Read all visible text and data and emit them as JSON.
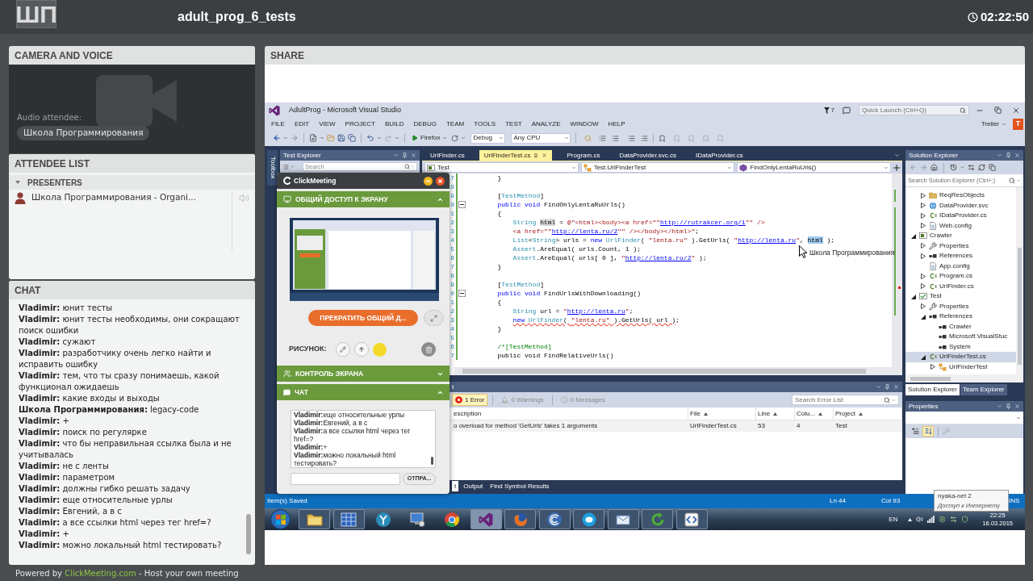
{
  "header": {
    "logo": "ШП",
    "title": "adult_prog_6_tests",
    "timer": "02:22:50"
  },
  "camera_panel": {
    "title": "CAMERA AND VOICE",
    "audio_label": "Audio attendee:",
    "attendee_badge": "Школа Программирования"
  },
  "attendee_panel": {
    "title": "ATTENDEE LIST",
    "groups": [
      {
        "title": "PRESENTERS",
        "expanded": true,
        "attendees": [
          {
            "name": "Школа Программирования - Organi..."
          }
        ]
      }
    ]
  },
  "chat_panel": {
    "title": "CHAT",
    "messages": [
      "**Vladimir:** юнит тесты",
      "**Vladimir:** юнит тесты необходимы, они сокращают поиск ошибки",
      "**Vladimir:** сужают",
      "**Vladimir:** разработчику очень легко найти и исправить ошибку",
      "**Vladimir:** тем, что ты сразу понимаешь, какой функционал ожидаешь",
      "**Vladimir:** какие входы и выходы",
      "**Школа Программирования:** legacy-code",
      "**Vladimir:** +",
      "**Vladimir:** поиск по регулярке",
      "**Vladimir:** что бы неправильная ссылка была и не учитывалась",
      "**Vladimir:** не с ленты",
      "**Vladimir:** параметром",
      "**Vladimir:** должны гибко решать задачу",
      "**Vladimir:** еще относительные урлы",
      "**Vladimir:** Евгений, а в с",
      "**Vladimir:** а все ссылки html через тег href=?",
      "**Vladimir:** +",
      "**Vladimir:** можно локальный html тестировать?"
    ]
  },
  "footer": {
    "prefix": "Powered by",
    "link": "ClickMeeting.com",
    "suffix": "- Host your own meeting"
  },
  "share_panel": {
    "title": "SHARE",
    "shared_screen": {
      "title_bar": {
        "title": "AdultProg - Microsoft Visual Studio",
        "notifications": "7",
        "quick_launch": {
          "placeholder": "Quick Launch (Ctrl+Q)"
        }
      },
      "menu": [
        "FILE",
        "EDIT",
        "VIEW",
        "PROJECT",
        "BUILD",
        "DEBUG",
        "TEAM",
        "TOOLS",
        "TEST",
        "ANALYZE",
        "WINDOW",
        "HELP"
      ],
      "account": {
        "name": "Treller",
        "initial": "T"
      },
      "toolbar": {
        "run_target": "Firefox",
        "configuration": "Debug",
        "platform": "Any CPU"
      },
      "toolbox": {
        "label": "Toolbox"
      },
      "test_explorer": {
        "title": "Test Explorer",
        "search": {
          "placeholder": "Search"
        }
      },
      "editor": {
        "tabs": [
          {
            "label": "UrlFinder.cs",
            "selected": false
          },
          {
            "label": "UrlFinderTest.cs",
            "selected": true
          },
          {
            "label": "Program.cs",
            "selected": false
          },
          {
            "label": "DataProvider.svc.cs",
            "selected": false
          },
          {
            "label": "IDataProvider.cs",
            "selected": false
          }
        ],
        "navigation": [
          {
            "kind": "project",
            "label": "Test"
          },
          {
            "kind": "class",
            "label": "Test.UrlFinderTest"
          },
          {
            "kind": "method",
            "label": "FindOnlyLentaRuUrls()"
          }
        ],
        "lines": [
          {
            "number": "7",
            "segments": [
              {
                "kind": "plain",
                "text": "        }"
              }
            ]
          },
          {
            "number": "8"
          },
          {
            "number": "9",
            "segments": [
              {
                "kind": "plain",
                "text": "        ["
              },
              {
                "kind": "type",
                "text": "TestMethod"
              },
              {
                "kind": "plain",
                "text": "]"
              }
            ]
          },
          {
            "number": "0",
            "expanded": true,
            "segments": [
              {
                "kind": "keyword",
                "text": "        public void"
              },
              {
                "kind": "plain",
                "text": " FindOnlyLentaRuUrls()"
              }
            ]
          },
          {
            "number": "1",
            "segments": [
              {
                "kind": "plain",
                "text": "        {"
              }
            ]
          },
          {
            "number": "2",
            "segments": [
              {
                "kind": "type",
                "text": "            String "
              },
              {
                "kind": "highlight",
                "text": "html"
              },
              {
                "kind": "plain",
                "text": " = "
              },
              {
                "kind": "string",
                "text": "@\"<html><body><a href=\"\""
              },
              {
                "kind": "link",
                "text": "http://rutrakcer.org/1"
              },
              {
                "kind": "string",
                "text": "\"\" />"
              }
            ]
          },
          {
            "number": "3",
            "segments": [
              {
                "kind": "string",
                "text": "            <a href=\"\""
              },
              {
                "kind": "link",
                "text": "http://lenta.ru/2"
              },
              {
                "kind": "string",
                "text": "\"\" /></body></html>\""
              },
              {
                "kind": "plain",
                "text": ";"
              }
            ]
          },
          {
            "number": "4",
            "segments": [
              {
                "kind": "type",
                "text": "            List"
              },
              {
                "kind": "plain",
                "text": "<"
              },
              {
                "kind": "type",
                "text": "String"
              },
              {
                "kind": "plain",
                "text": "> urls = "
              },
              {
                "kind": "keyword",
                "text": "new"
              },
              {
                "kind": "type",
                "text": " UrlFinder"
              },
              {
                "kind": "plain",
                "text": "( "
              },
              {
                "kind": "string",
                "text": "\"lenta.ru\""
              },
              {
                "kind": "plain",
                "text": " ).GetUrls( "
              },
              {
                "kind": "string",
                "text": "\""
              },
              {
                "kind": "link",
                "text": "http://lenta.ru"
              },
              {
                "kind": "string",
                "text": "\""
              },
              {
                "kind": "plain",
                "text": ", "
              },
              {
                "kind": "selection",
                "text": "html"
              },
              {
                "kind": "plain",
                "text": " );"
              }
            ]
          },
          {
            "number": "5",
            "segments": [
              {
                "kind": "type",
                "text": "            Assert"
              },
              {
                "kind": "plain",
                "text": ".AreEqual( urls.Count, 1 );"
              }
            ]
          },
          {
            "number": "6",
            "segments": [
              {
                "kind": "type",
                "text": "            Assert"
              },
              {
                "kind": "plain",
                "text": ".AreEqual( urls[ 0 ], "
              },
              {
                "kind": "string",
                "text": "\""
              },
              {
                "kind": "link",
                "text": "http://lenta.ru/2"
              },
              {
                "kind": "string",
                "text": "\""
              },
              {
                "kind": "plain",
                "text": " );"
              }
            ]
          },
          {
            "number": "7",
            "segments": [
              {
                "kind": "plain",
                "text": "        }"
              }
            ]
          },
          {
            "number": "8"
          },
          {
            "number": "9",
            "segments": [
              {
                "kind": "plain",
                "text": "        ["
              },
              {
                "kind": "type",
                "text": "TestMethod"
              },
              {
                "kind": "plain",
                "text": "]"
              }
            ]
          },
          {
            "number": "0",
            "expanded": true,
            "segments": [
              {
                "kind": "keyword",
                "text": "        public void"
              },
              {
                "kind": "plain",
                "text": " FindUrlsWithDownloading()"
              }
            ]
          },
          {
            "number": "1",
            "segments": [
              {
                "kind": "plain",
                "text": "        {"
              }
            ]
          },
          {
            "number": "2",
            "segments": [
              {
                "kind": "type",
                "text": "            String"
              },
              {
                "kind": "plain",
                "text": " url = "
              },
              {
                "kind": "string",
                "text": "\""
              },
              {
                "kind": "link",
                "text": "http://lenta.ru"
              },
              {
                "kind": "string",
                "text": "\""
              },
              {
                "kind": "plain",
                "text": ";"
              }
            ]
          },
          {
            "number": "3",
            "segments": [
              {
                "kind": "error",
                "parts": [
                  {
                    "kind": "keyword",
                    "text": "            new"
                  },
                  {
                    "kind": "type",
                    "text": " UrlFinder"
                  },
                  {
                    "kind": "plain",
                    "text": "( "
                  },
                  {
                    "kind": "string",
                    "text": "\"lenta.ru\""
                  },
                  {
                    "kind": "plain",
                    "text": " ).GetUrls( url )"
                  }
                ]
              },
              {
                "kind": "plain",
                "text": ";"
              }
            ]
          },
          {
            "number": "4",
            "segments": [
              {
                "kind": "plain",
                "text": "        }"
              }
            ]
          },
          {
            "number": "5"
          },
          {
            "number": "6",
            "segments": [
              {
                "kind": "comment",
                "text": "        /*[TestMethod]"
              }
            ]
          },
          {
            "number": "7",
            "segments": [
              {
                "kind": "plain",
                "text": "        public void FindRelativeUrls()"
              }
            ]
          }
        ]
      },
      "error_list": {
        "title": "t",
        "filters": [
          {
            "kind": "error",
            "label": "1 Error",
            "selected": true
          },
          {
            "kind": "warning",
            "label": "0 Warnings",
            "selected": false
          },
          {
            "kind": "message",
            "label": "0 Messages",
            "selected": false
          }
        ],
        "search": {
          "placeholder": "Search Error List"
        },
        "columns": [
          {
            "label": "escription",
            "sorted": false
          },
          {
            "label": "File",
            "sorted": true
          },
          {
            "label": "Line",
            "sorted": true
          },
          {
            "label": "Colu...",
            "sorted": true
          },
          {
            "label": "Project",
            "sorted": true
          }
        ],
        "rows": [
          [
            "o overload for method 'GetUrls' takes 1 arguments",
            "UrlFinderTest.cs",
            "53",
            "4",
            "Test"
          ]
        ],
        "tabs": [
          {
            "label": "t",
            "selected": true
          },
          {
            "label": "Output",
            "selected": false
          },
          {
            "label": "Find Symbol Results",
            "selected": false
          }
        ]
      },
      "solution_explorer": {
        "title": "Solution Explorer",
        "search": {
          "placeholder": "Search Solution Explorer (Ctrl+;)"
        },
        "tree_continued": [
          {
            "label": "ReqResObjects",
            "kind": "folder",
            "expanded": false,
            "selected": false
          },
          {
            "label": "DataProvider.svc",
            "kind": "service",
            "expanded": false,
            "selected": false
          },
          {
            "label": "IDataProvider.cs",
            "kind": "csharp",
            "expanded": false,
            "selected": false
          },
          {
            "label": "Web.config",
            "kind": "config",
            "expanded": false,
            "selected": false
          }
        ],
        "tree": [
          {
            "label": "Crawler",
            "kind": "project",
            "expanded": true,
            "selected": false,
            "children": [
              {
                "label": "Properties",
                "kind": "properties",
                "expanded": false,
                "selected": false
              },
              {
                "label": "References",
                "kind": "references",
                "expanded": false,
                "selected": false
              },
              {
                "label": "App.config",
                "kind": "config",
                "selected": false
              },
              {
                "label": "Program.cs",
                "kind": "csharp",
                "expanded": false,
                "selected": false
              },
              {
                "label": "UrlFinder.cs",
                "kind": "csharp",
                "expanded": false,
                "selected": false
              }
            ]
          },
          {
            "label": "Test",
            "kind": "testproject",
            "expanded": true,
            "selected": false,
            "children": [
              {
                "label": "Properties",
                "kind": "properties",
                "expanded": false,
                "selected": false
              },
              {
                "label": "References",
                "kind": "references",
                "expanded": true,
                "selected": false,
                "children": [
                  {
                    "label": "Crawler",
                    "kind": "assembly",
                    "selected": false
                  },
                  {
                    "label": "Microsoft.VisualStuc",
                    "kind": "assembly",
                    "selected": false
                  },
                  {
                    "label": "System",
                    "kind": "assembly",
                    "selected": false
                  }
                ]
              },
              {
                "label": "UrlFinderTest.cs",
                "kind": "csharp",
                "expanded": true,
                "selected": true,
                "children": [
                  {
                    "label": "UrlFinderTest",
                    "kind": "class",
                    "expanded": false,
                    "selected": false
                  }
                ]
              }
            ]
          }
        ],
        "tabs": [
          {
            "label": "Solution Explorer",
            "selected": true
          },
          {
            "label": "Team Explorer",
            "selected": false
          }
        ]
      },
      "properties": {
        "title": "Properties",
        "views": [
          {
            "kind": "categorized",
            "selected": false
          },
          {
            "kind": "alphabetical",
            "selected": true
          }
        ]
      },
      "status_bar": {
        "message": "Item(s) Saved",
        "line": "Ln 44",
        "column": "Col 93",
        "mode": "INS"
      },
      "taskbar": {
        "apps": [
          {
            "kind": "folder",
            "running": true,
            "selected": false
          },
          {
            "kind": "grid",
            "running": true,
            "selected": false
          },
          {
            "kind": "branch",
            "running": false,
            "selected": false
          },
          {
            "kind": "monitor",
            "running": false,
            "selected": false
          },
          {
            "kind": "wheel",
            "running": false,
            "selected": false
          },
          {
            "kind": "ribbon",
            "running": true,
            "selected": true
          },
          {
            "kind": "fox",
            "running": true,
            "selected": false
          },
          {
            "kind": "swirl",
            "running": true,
            "selected": false
          },
          {
            "kind": "bubble",
            "running": true,
            "selected": false
          },
          {
            "kind": "mail",
            "running": true,
            "selected": false
          },
          {
            "kind": "cycle",
            "running": true,
            "selected": false
          },
          {
            "kind": "brackets",
            "running": true,
            "selected": false
          }
        ],
        "language": "EN",
        "time": "22:25",
        "date": "16.03.2015"
      },
      "network_tooltip": {
        "title": "nyaka-net 2",
        "subtitle": "Доступ к Интернету"
      },
      "presenter_cursor": {
        "label": "Школа Программирования"
      },
      "clickmeeting_panel": {
        "brand": "ClickMeeting",
        "screen_share": {
          "title": "ОБЩИЙ ДОСТУП К ЭКРАНУ",
          "expanded": true,
          "stop_button": "ПРЕКРАТИТЬ ОБЩИЙ Д...",
          "drawing_label": "РИСУНОК:"
        },
        "screen_control": {
          "title": "КОНТРОЛЬ ЭКРАНА",
          "expanded": false
        },
        "chat": {
          "title": "ЧАТ",
          "expanded": true,
          "messages": [
            "**Vladimir:**еще относительные урлы",
            "**Vladimir:**Евгений, а в с",
            "**Vladimir:**а все ссылки html через тег href=?",
            "**Vladimir:**+",
            "**Vladimir:**можно локальный html тестировать?"
          ],
          "send_button": "ОТПРА..."
        }
      }
    }
  }
}
